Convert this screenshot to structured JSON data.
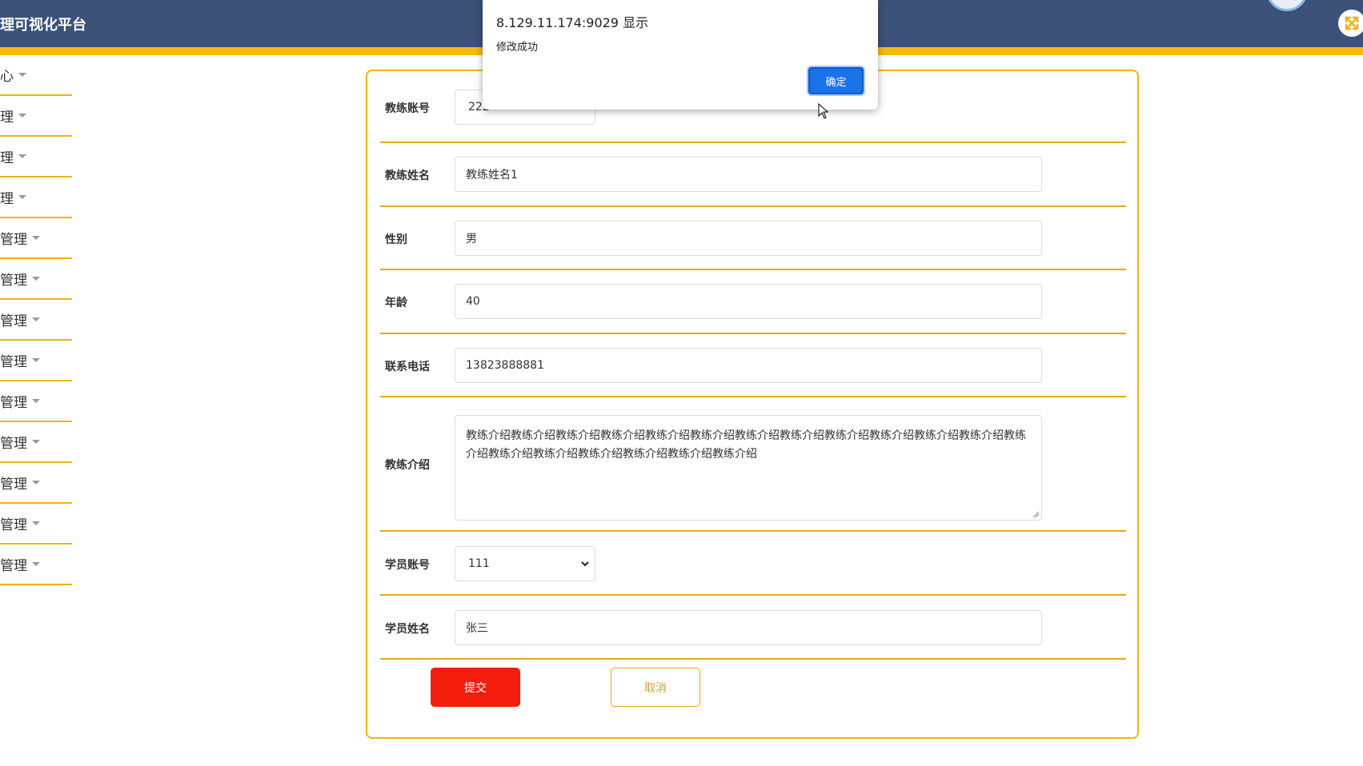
{
  "header": {
    "title": "理可视化平台",
    "colors": {
      "background": "#3d5278",
      "accent_bar": "#f9b712"
    }
  },
  "header_icons": {
    "fullscreen": "fullscreen-icon"
  },
  "sidebar": {
    "items": [
      {
        "label": "心"
      },
      {
        "label": "理"
      },
      {
        "label": "理"
      },
      {
        "label": "理"
      },
      {
        "label": "管理"
      },
      {
        "label": "管理"
      },
      {
        "label": "管理"
      },
      {
        "label": "管理"
      },
      {
        "label": "管理"
      },
      {
        "label": "管理"
      },
      {
        "label": "管理"
      },
      {
        "label": "管理"
      },
      {
        "label": "管理"
      }
    ],
    "caret_icon": "caret-down-icon"
  },
  "form": {
    "coach_account": {
      "label": "教练账号",
      "value": "222"
    },
    "coach_name": {
      "label": "教练姓名",
      "value": "教练姓名1"
    },
    "gender": {
      "label": "性别",
      "value": "男"
    },
    "age": {
      "label": "年龄",
      "value": "40"
    },
    "phone": {
      "label": "联系电话",
      "value": "13823888881"
    },
    "intro": {
      "label": "教练介绍",
      "value": "教练介绍教练介绍教练介绍教练介绍教练介绍教练介绍教练介绍教练介绍教练介绍教练介绍教练介绍教练介绍教练介绍教练介绍教练介绍教练介绍教练介绍教练介绍教练介绍"
    },
    "student_account": {
      "label": "学员账号",
      "value": "111"
    },
    "student_name": {
      "label": "学员姓名",
      "value": "张三"
    },
    "submit_label": "提交",
    "cancel_label": "取消",
    "colors": {
      "border": "#f1b216",
      "submit": "#f51d0c"
    }
  },
  "dialog": {
    "origin": "8.129.11.174:9029 显示",
    "message": "修改成功",
    "ok_label": "确定",
    "ok_color": "#1a73e8"
  }
}
